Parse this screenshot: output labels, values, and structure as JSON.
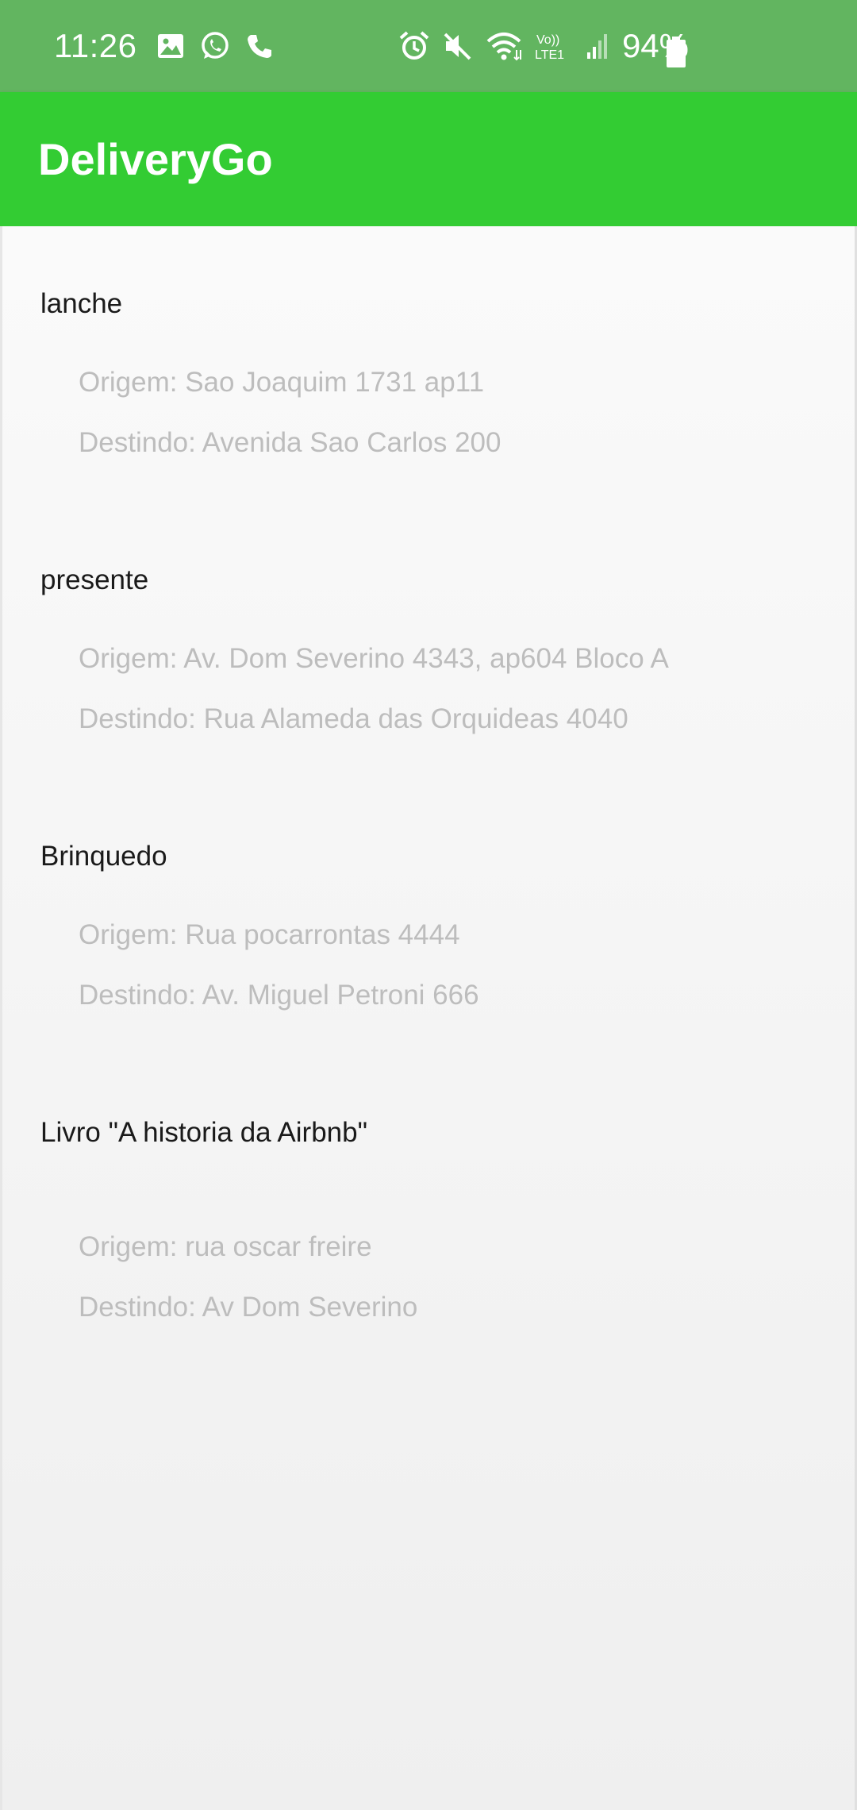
{
  "status_bar": {
    "time": "11:26",
    "left_icons": [
      "image-icon",
      "whatsapp-icon",
      "phone-icon"
    ],
    "right_icons": [
      "alarm-icon",
      "mute-icon",
      "wifi-icon",
      "volte-lte-icon",
      "signal-icon"
    ],
    "volte_label_top": "Vo))",
    "volte_label_bottom": "LTE1",
    "battery_percent": "94%",
    "battery_level": 0.94,
    "color": "#62b560"
  },
  "app_bar": {
    "title": "DeliveryGo",
    "color": "#33cc33"
  },
  "deliveries": [
    {
      "title": "lanche",
      "origin": "Origem: Sao Joaquim 1731 ap11",
      "destination": "Destindo: Avenida Sao Carlos 200"
    },
    {
      "title": "presente",
      "origin": "Origem: Av. Dom Severino 4343, ap604 Bloco A",
      "destination": "Destindo: Rua Alameda das Orquideas 4040"
    },
    {
      "title": "Brinquedo",
      "origin": "Origem: Rua pocarrontas 4444",
      "destination": "Destindo: Av. Miguel Petroni 666"
    },
    {
      "title": "Livro \"A historia da Airbnb\"",
      "origin": "Origem: rua oscar freire",
      "destination": "Destindo: Av Dom Severino"
    }
  ]
}
